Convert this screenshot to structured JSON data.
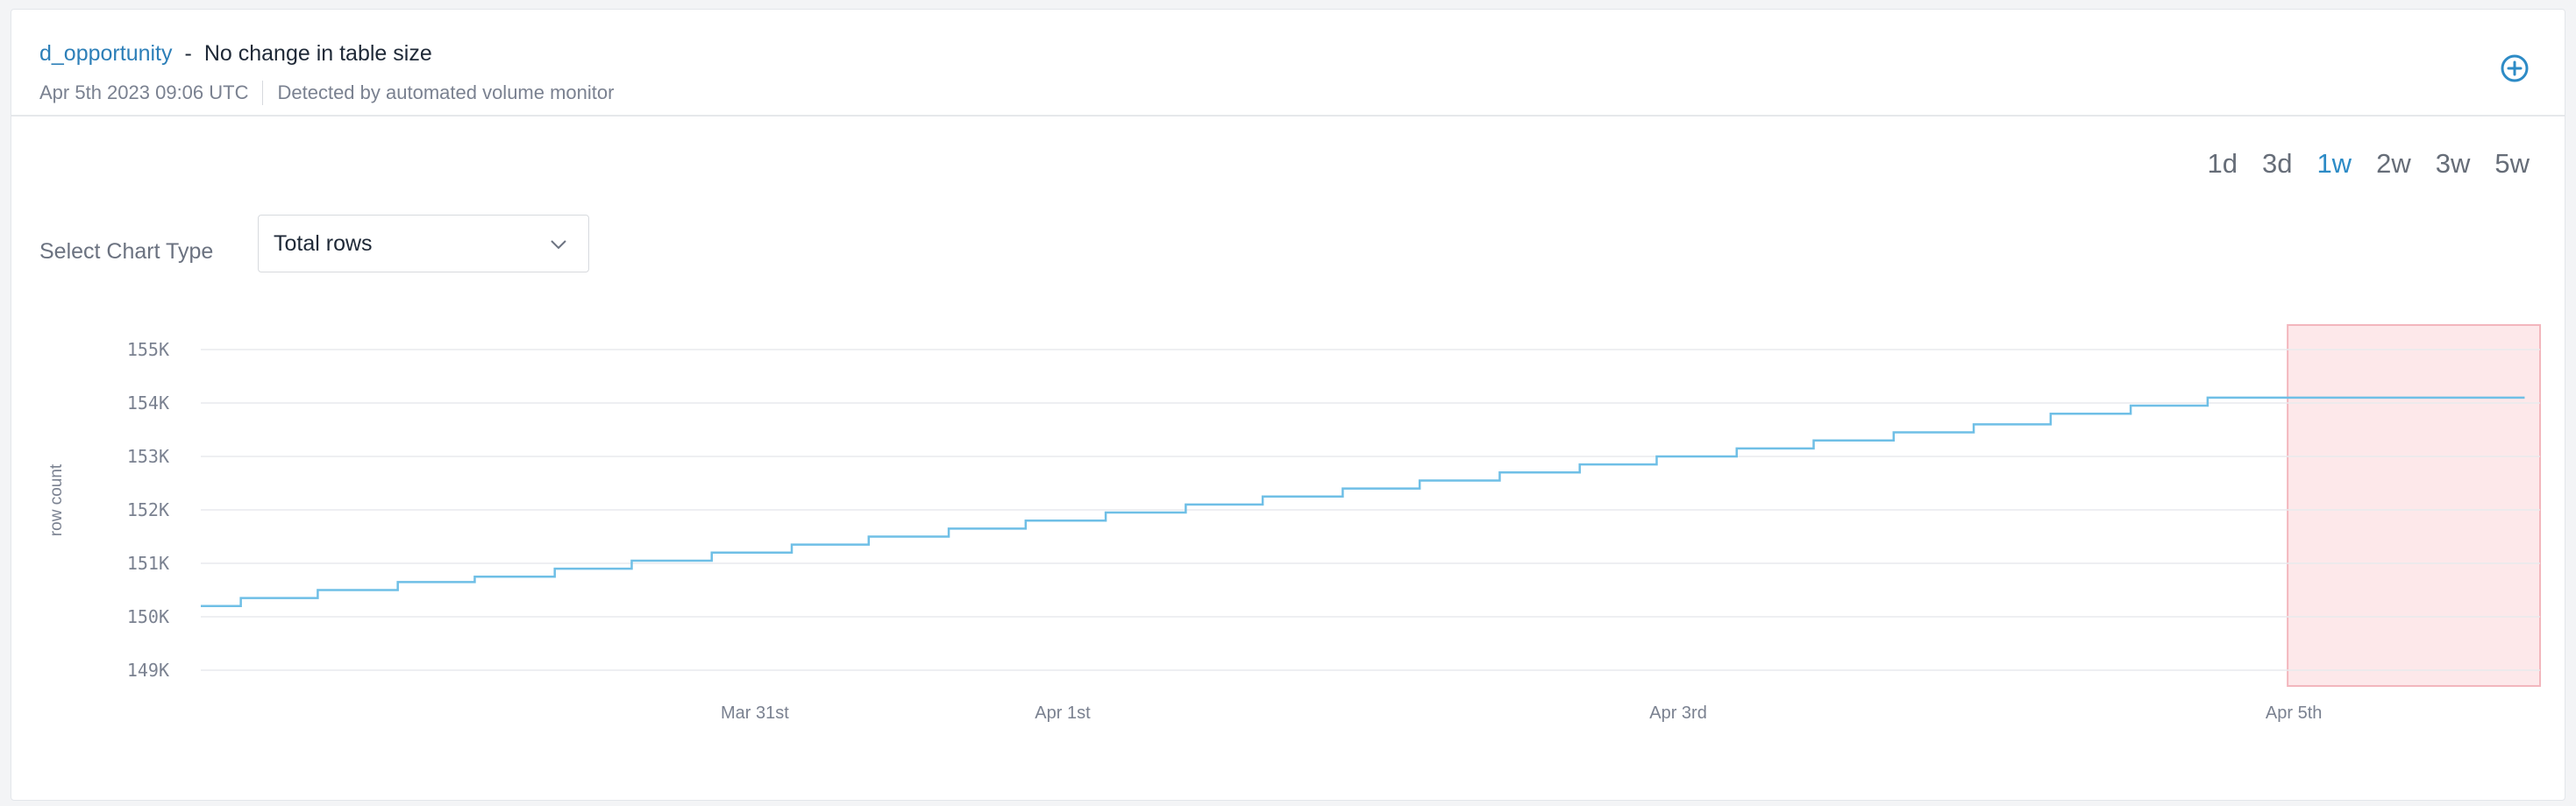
{
  "header": {
    "table_name": "d_opportunity",
    "separator": "-",
    "title": "No change in table size",
    "timestamp": "Apr 5th 2023 09:06 UTC",
    "detected_by": "Detected by automated volume monitor"
  },
  "range_tabs": [
    {
      "label": "1d",
      "active": false
    },
    {
      "label": "3d",
      "active": false
    },
    {
      "label": "1w",
      "active": true
    },
    {
      "label": "2w",
      "active": false
    },
    {
      "label": "3w",
      "active": false
    },
    {
      "label": "5w",
      "active": false
    }
  ],
  "chart_type": {
    "label": "Select Chart Type",
    "selected": "Total rows"
  },
  "icons": {
    "add": "add-circle-icon",
    "dropdown": "chevron-down-icon"
  },
  "colors": {
    "accent": "#2d8bc6",
    "line": "#6fbfe6",
    "anomaly_fill": "#fde8ea",
    "anomaly_stroke": "#f3b6bd"
  },
  "chart_data": {
    "type": "line",
    "interpolation": "step",
    "ylabel": "row count",
    "xlabel": "",
    "ylim": [
      149000,
      155000
    ],
    "y_ticks": [
      {
        "value": 155000,
        "label": "155K"
      },
      {
        "value": 154000,
        "label": "154K"
      },
      {
        "value": 153000,
        "label": "153K"
      },
      {
        "value": 152000,
        "label": "152K"
      },
      {
        "value": 151000,
        "label": "151K"
      },
      {
        "value": 150000,
        "label": "150K"
      },
      {
        "value": 149000,
        "label": "149K"
      }
    ],
    "x_ticks": [
      {
        "label": "Mar 31st",
        "day": 1.8
      },
      {
        "label": "Apr 1st",
        "day": 2.8
      },
      {
        "label": "Apr 3rd",
        "day": 4.8
      },
      {
        "label": "Apr 5th",
        "day": 6.8
      }
    ],
    "xlim": [
      0,
      7.6
    ],
    "grid": true,
    "series": [
      {
        "x": [
          0,
          0.13,
          0.38,
          0.64,
          0.89,
          1.15,
          1.4,
          1.66,
          1.92,
          2.17,
          2.43,
          2.68,
          2.94,
          3.2,
          3.45,
          3.71,
          3.96,
          4.22,
          4.48,
          4.73,
          4.99,
          5.24,
          5.5,
          5.76,
          6.01,
          6.27,
          6.52,
          6.78,
          7.04,
          7.29,
          7.55
        ],
        "values": [
          150200,
          150350,
          150500,
          150650,
          150750,
          150900,
          151050,
          151200,
          151350,
          151500,
          151650,
          151800,
          151950,
          152100,
          152250,
          152400,
          152550,
          152700,
          152850,
          153000,
          153150,
          153300,
          153450,
          153600,
          153800,
          153950,
          154100,
          154100,
          154100,
          154100,
          154100
        ]
      }
    ],
    "anomaly_region": {
      "x_start": 6.78,
      "x_end": 7.6
    }
  }
}
